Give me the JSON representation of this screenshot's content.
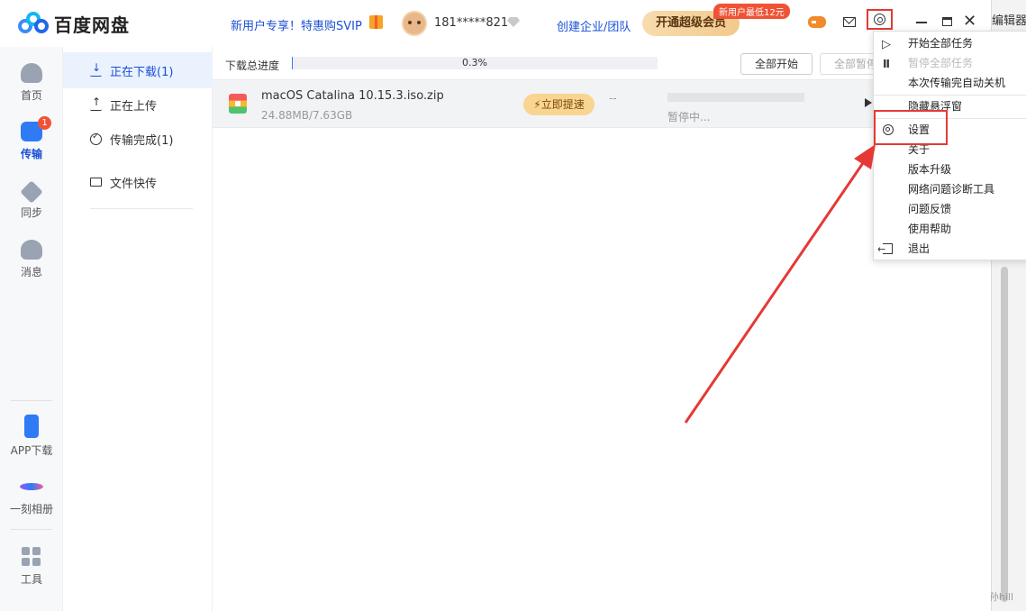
{
  "app": {
    "title": "百度网盘",
    "promo": "新用户专享！特惠购SVIP",
    "username": "181*****821",
    "enterprise_link": "创建企业/团队",
    "vip_button": "开通超级会员",
    "vip_tag": "新用户最低12元"
  },
  "background": {
    "editor_label": "编辑器",
    "watermark": "CSDN @孙hill"
  },
  "leftnav": {
    "items": [
      {
        "label": "首页",
        "icon": "cloud-icon"
      },
      {
        "label": "传输",
        "icon": "transfer-icon",
        "badge": "1"
      },
      {
        "label": "同步",
        "icon": "sync-icon"
      },
      {
        "label": "消息",
        "icon": "message-icon"
      },
      {
        "label": "APP下载",
        "icon": "phone-icon"
      },
      {
        "label": "一刻相册",
        "icon": "album-icon"
      },
      {
        "label": "工具",
        "icon": "tools-icon"
      }
    ]
  },
  "subnav": {
    "items": [
      {
        "label": "正在下载(1)",
        "icon": "download-icon"
      },
      {
        "label": "正在上传",
        "icon": "upload-icon"
      },
      {
        "label": "传输完成(1)",
        "icon": "check-circle-icon"
      },
      {
        "label": "文件快传",
        "icon": "monitor-icon"
      }
    ]
  },
  "content": {
    "progress_label": "下载总进度",
    "progress_percent": "0.3%",
    "progress_value": 0.003,
    "start_all": "全部开始",
    "pause_all": "全部暂停",
    "file": {
      "name": "macOS Catalina 10.15.3.iso.zip",
      "size": "24.88MB/7.63GB",
      "speedup": "立即提速",
      "speed": "--",
      "status": "暂停中..."
    }
  },
  "menu": {
    "items": [
      {
        "label": "开始全部任务",
        "icon": "play-icon",
        "disabled": false
      },
      {
        "label": "暂停全部任务",
        "icon": "pause-icon",
        "disabled": true
      },
      {
        "label": "本次传输完自动关机",
        "icon": "",
        "disabled": false
      },
      {
        "label": "隐藏悬浮窗",
        "icon": "",
        "disabled": false
      },
      {
        "label": "设置",
        "icon": "gear-icon",
        "disabled": false
      },
      {
        "label": "关于",
        "icon": "",
        "disabled": false
      },
      {
        "label": "版本升级",
        "icon": "",
        "disabled": false
      },
      {
        "label": "网络问题诊断工具",
        "icon": "",
        "disabled": false
      },
      {
        "label": "问题反馈",
        "icon": "",
        "disabled": false
      },
      {
        "label": "使用帮助",
        "icon": "",
        "disabled": false
      },
      {
        "label": "退出",
        "icon": "exit-icon",
        "disabled": false
      }
    ]
  },
  "colors": {
    "accent": "#2f7bf5",
    "annotation_red": "#e53935",
    "link_blue": "#1a4fd6"
  }
}
